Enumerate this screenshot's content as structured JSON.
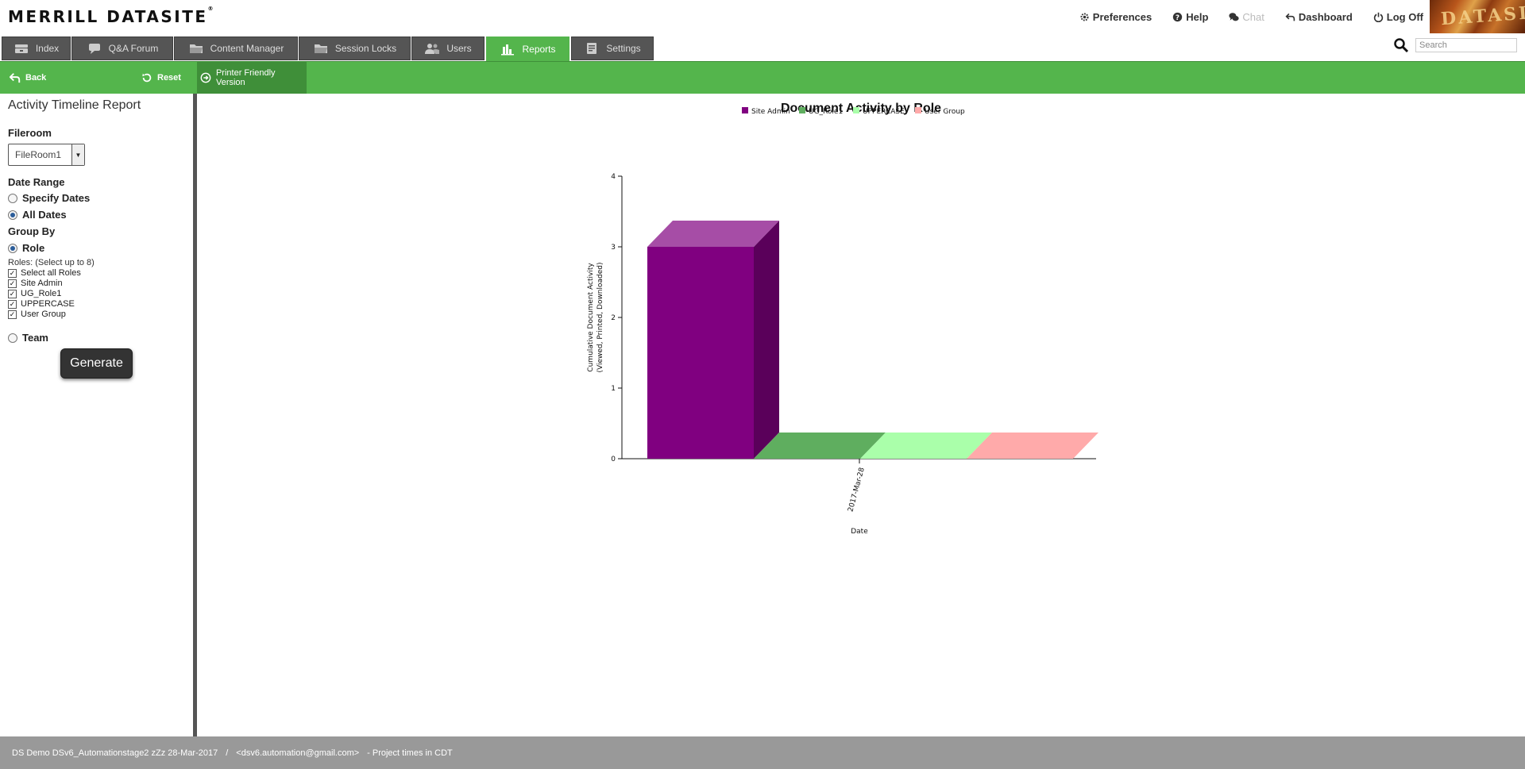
{
  "header": {
    "logo": "MERRILL DATASITE",
    "logo_mark": "®",
    "links": [
      {
        "label": "Preferences",
        "icon": "gear-icon",
        "disabled": false
      },
      {
        "label": "Help",
        "icon": "help-icon",
        "disabled": false
      },
      {
        "label": "Chat",
        "icon": "chat-icon",
        "disabled": true
      },
      {
        "label": "Dashboard",
        "icon": "back-arrow-icon",
        "disabled": false
      },
      {
        "label": "Log Off",
        "icon": "power-icon",
        "disabled": false
      }
    ],
    "brand_image_text": "DATASITE"
  },
  "tabs": [
    {
      "label": "Index",
      "icon": "index-icon",
      "active": false
    },
    {
      "label": "Q&A Forum",
      "icon": "speech-bubble-icon",
      "active": false
    },
    {
      "label": "Content Manager",
      "icon": "folder-icon",
      "active": false
    },
    {
      "label": "Session Locks",
      "icon": "folder-icon",
      "active": false
    },
    {
      "label": "Users",
      "icon": "users-icon",
      "active": false
    },
    {
      "label": "Reports",
      "icon": "bar-chart-icon",
      "active": true
    },
    {
      "label": "Settings",
      "icon": "settings-icon",
      "active": false
    }
  ],
  "search": {
    "placeholder": "Search",
    "value": ""
  },
  "toolbar": {
    "back_label": "Back",
    "reset_label": "Reset",
    "printer_label": "Printer Friendly Version"
  },
  "left_panel": {
    "title": "Activity Timeline Report",
    "fileroom_label": "Fileroom",
    "fileroom_value": "FileRoom1",
    "date_range_label": "Date Range",
    "specify_dates_label": "Specify Dates",
    "all_dates_label": "All Dates",
    "date_range_selected": "All Dates",
    "group_by_label": "Group By",
    "role_label": "Role",
    "team_label": "Team",
    "group_by_selected": "Role",
    "roles_hint": "Roles: (Select up to 8)",
    "roles": [
      {
        "label": "Select all Roles",
        "checked": true
      },
      {
        "label": "Site Admin",
        "checked": true
      },
      {
        "label": "UG_Role1",
        "checked": true
      },
      {
        "label": "UPPERCASE",
        "checked": true
      },
      {
        "label": "User Group",
        "checked": true
      }
    ],
    "generate_label": "Generate"
  },
  "chart_data": {
    "type": "bar",
    "title": "Document Activity by Role",
    "xlabel": "Date",
    "ylabel_lines": [
      "Cumulative Document Activity",
      "(Viewed, Printed, Downloaded)"
    ],
    "categories": [
      "2017-Mar-28"
    ],
    "ylim": [
      0,
      4
    ],
    "yticks": [
      0,
      1,
      2,
      3,
      4
    ],
    "style": "3d",
    "legend_position": "top-center",
    "series": [
      {
        "name": "Site Admin",
        "values": [
          3
        ],
        "color": "#800080"
      },
      {
        "name": "UG_Role1",
        "values": [
          0
        ],
        "color": "#5fae5f"
      },
      {
        "name": "UPPERCASE",
        "values": [
          0
        ],
        "color": "#aaffaa"
      },
      {
        "name": "User Group",
        "values": [
          0
        ],
        "color": "#ffaaaa"
      }
    ]
  },
  "footer": {
    "project": "DS Demo DSv6_Automationstage2 zZz 28-Mar-2017",
    "separator": "/",
    "email": "<dsv6.automation@gmail.com>",
    "timezone": " - Project times in CDT"
  }
}
